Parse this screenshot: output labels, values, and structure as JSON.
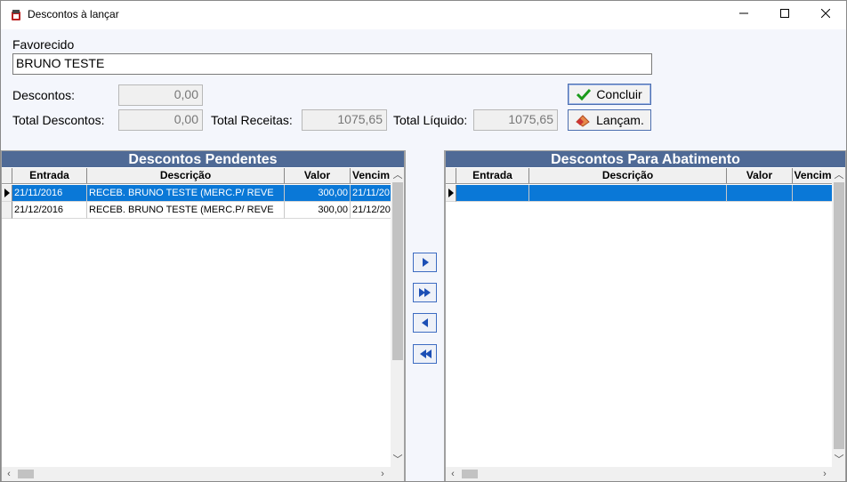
{
  "window": {
    "title": "Descontos à lançar",
    "icon": "app-icon",
    "controls": {
      "minimize": "—",
      "maximize": "☐",
      "close": "✕"
    }
  },
  "form": {
    "favorecido_label": "Favorecido",
    "favorecido_value": "BRUNO TESTE",
    "descontos_label": "Descontos:",
    "descontos_value": "0,00",
    "total_descontos_label": "Total Descontos:",
    "total_descontos_value": "0,00",
    "total_receitas_label": "Total Receitas:",
    "total_receitas_value": "1075,65",
    "total_liquido_label": "Total Líquido:",
    "total_liquido_value": "1075,65",
    "concluir_label": "Concluir",
    "lancam_label": "Lançam."
  },
  "pendentes": {
    "title": "Descontos Pendentes",
    "columns": [
      "Entrada",
      "Descrição",
      "Valor",
      "Vencim"
    ],
    "rows": [
      {
        "entrada": "21/11/2016",
        "descricao": "RECEB. BRUNO TESTE (MERC.P/ REVE",
        "valor": "300,00",
        "vencimento": "21/11/20"
      },
      {
        "entrada": "21/12/2016",
        "descricao": "RECEB. BRUNO TESTE (MERC.P/ REVE",
        "valor": "300,00",
        "vencimento": "21/12/20"
      }
    ]
  },
  "abatimento": {
    "title": "Descontos Para Abatimento",
    "columns": [
      "Entrada",
      "Descrição",
      "Valor",
      "Vencim"
    ]
  },
  "move_buttons": [
    "move-one-right",
    "move-all-right",
    "move-one-left",
    "move-all-left"
  ],
  "colors": {
    "header_bar": "#4f6a96",
    "selection": "#0a78d7",
    "button_border": "#3d6cc2"
  }
}
